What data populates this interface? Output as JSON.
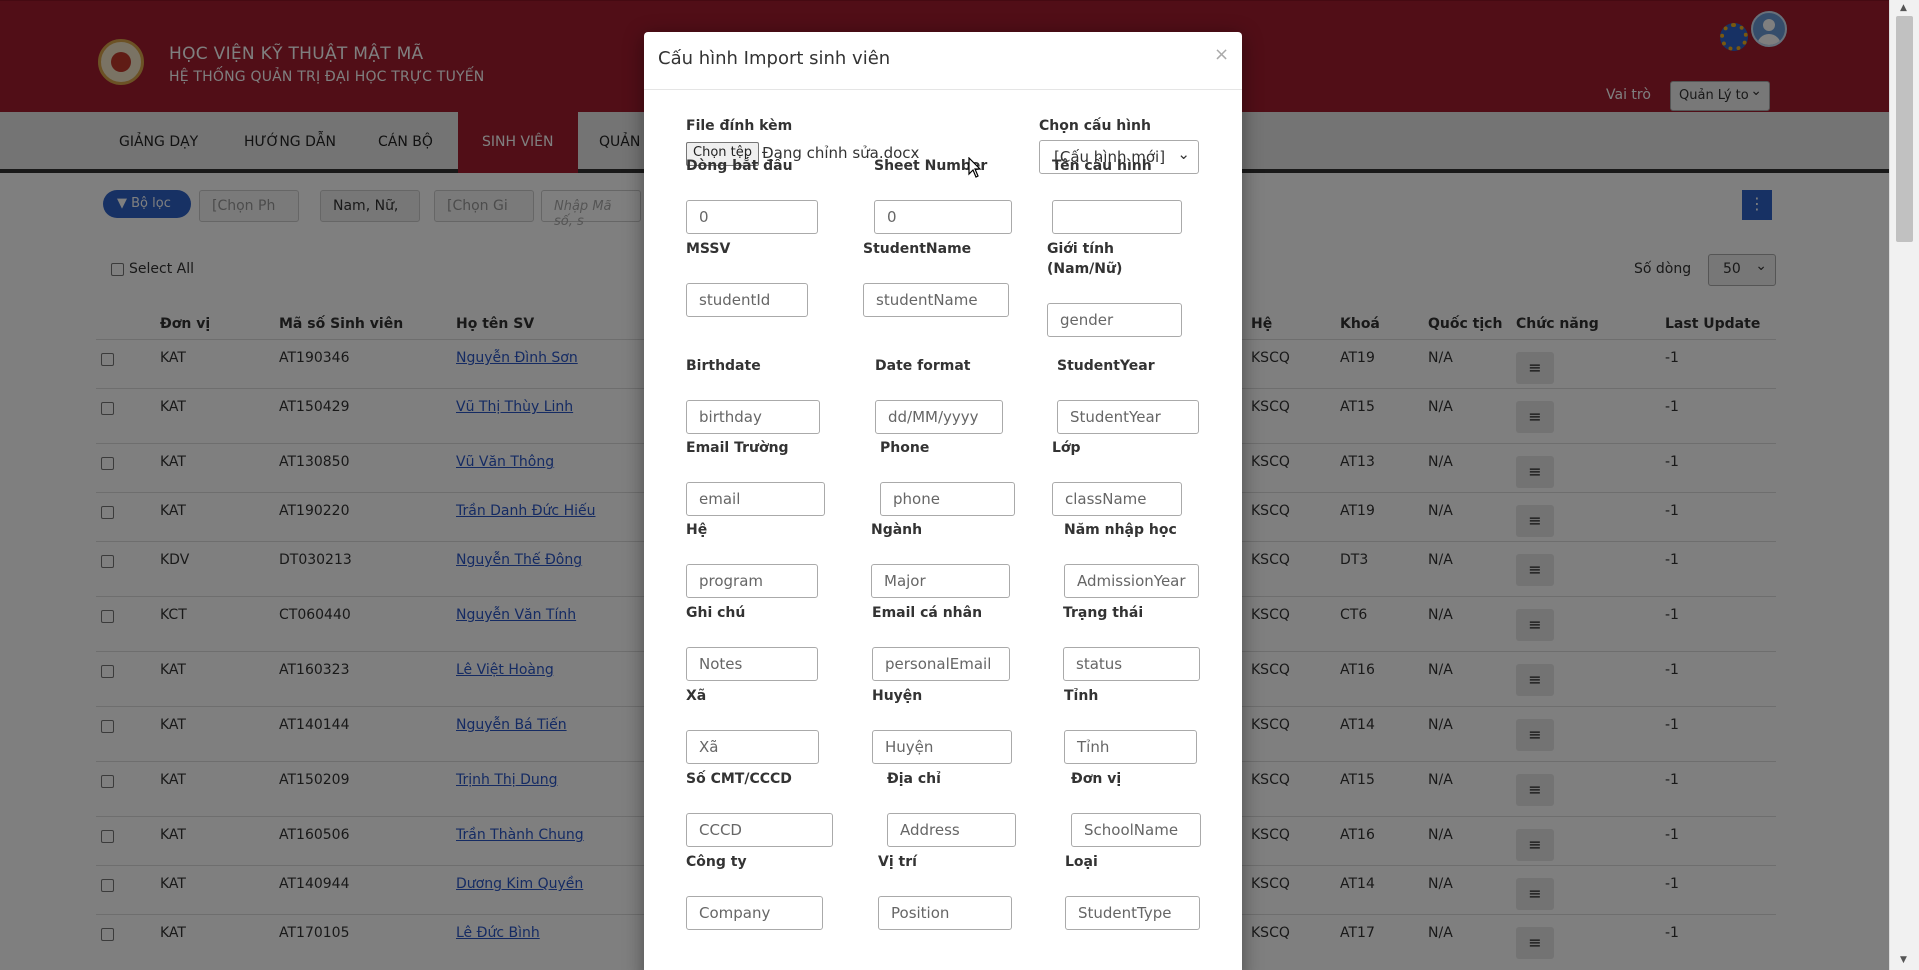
{
  "header": {
    "title1": "HỌC VIỆN KỸ THUẬT MẬT MÃ",
    "title2": "HỆ THỐNG QUẢN TRỊ ĐẠI HỌC TRỰC TUYẾN",
    "role_label": "Vai trò",
    "role_value": "Quản Lý to"
  },
  "nav": [
    "GIẢNG DẠY",
    "HƯỚNG DẪN",
    "CÁN BỘ",
    "SINH VIÊN",
    "QUẢN"
  ],
  "filters": {
    "filter_button": "Bộ lọc",
    "sel1": "[Chọn Ph",
    "sel2": "Nam, Nữ,",
    "sel3": "[Chọn Gi",
    "search_placeholder": "Nhập Mã số, s"
  },
  "toolbar": {
    "select_all": "Select All",
    "rows_label": "Số dòng",
    "rows_value": "50"
  },
  "table": {
    "headers": [
      "Đơn vị",
      "Mã số Sinh viên",
      "Họ tên SV",
      "Hệ",
      "Khoá",
      "Quốc tịch",
      "Chức năng",
      "Last Update"
    ],
    "rows": [
      {
        "dv": "KAT",
        "ma": "AT190346",
        "ten": "Nguyễn Đình Sơn",
        "he": "KSCQ",
        "khoa": "AT19",
        "qt": "N/A",
        "lu": "-1"
      },
      {
        "dv": "KAT",
        "ma": "AT150429",
        "ten": "Vũ Thị Thùy Linh",
        "he": "KSCQ",
        "khoa": "AT15",
        "qt": "N/A",
        "lu": "-1"
      },
      {
        "dv": "KAT",
        "ma": "AT130850",
        "ten": "Vũ Văn Thông",
        "he": "KSCQ",
        "khoa": "AT13",
        "qt": "N/A",
        "lu": "-1"
      },
      {
        "dv": "KAT",
        "ma": "AT190220",
        "ten": "Trần Danh Đức Hiếu",
        "he": "KSCQ",
        "khoa": "AT19",
        "qt": "N/A",
        "lu": "-1"
      },
      {
        "dv": "KDV",
        "ma": "DT030213",
        "ten": "Nguyễn Thế Đông",
        "he": "KSCQ",
        "khoa": "DT3",
        "qt": "N/A",
        "lu": "-1"
      },
      {
        "dv": "KCT",
        "ma": "CT060440",
        "ten": "Nguyễn Văn Tính",
        "he": "KSCQ",
        "khoa": "CT6",
        "qt": "N/A",
        "lu": "-1"
      },
      {
        "dv": "KAT",
        "ma": "AT160323",
        "ten": "Lê Việt Hoàng",
        "he": "KSCQ",
        "khoa": "AT16",
        "qt": "N/A",
        "lu": "-1"
      },
      {
        "dv": "KAT",
        "ma": "AT140144",
        "ten": "Nguyễn Bá Tiến",
        "he": "KSCQ",
        "khoa": "AT14",
        "qt": "N/A",
        "lu": "-1"
      },
      {
        "dv": "KAT",
        "ma": "AT150209",
        "ten": "Trịnh Thị Dung",
        "he": "KSCQ",
        "khoa": "AT15",
        "qt": "N/A",
        "lu": "-1"
      },
      {
        "dv": "KAT",
        "ma": "AT160506",
        "ten": "Trần Thành Chung",
        "he": "KSCQ",
        "khoa": "AT16",
        "qt": "N/A",
        "lu": "-1"
      },
      {
        "dv": "KAT",
        "ma": "AT140944",
        "ten": "Dương Kim Quyền",
        "he": "KSCQ",
        "khoa": "AT14",
        "qt": "N/A",
        "lu": "-1"
      },
      {
        "dv": "KAT",
        "ma": "AT170105",
        "ten": "Lê Đức Bình",
        "he": "KSCQ",
        "khoa": "AT17",
        "qt": "N/A",
        "lu": "-1"
      }
    ]
  },
  "modal": {
    "title": "Cấu hình Import sinh viên",
    "close": "×",
    "file_label": "File đính kèm",
    "file_button": "Chọn tệp",
    "file_name": "Đang chỉnh sửa.docx",
    "config_label": "Chọn cấu hình",
    "config_value": "[Cấu hình mới]",
    "fields": [
      {
        "label": "Dòng bắt đầu",
        "value": "0"
      },
      {
        "label": "Sheet Number",
        "value": "0"
      },
      {
        "label": "Tên cấu hình",
        "value": ""
      },
      {
        "label": "MSSV",
        "value": "studentId"
      },
      {
        "label": "StudentName",
        "value": "studentName"
      },
      {
        "label": "Giới tính (Nam/Nữ)",
        "value": "gender"
      },
      {
        "label": "Birthdate",
        "value": "birthday"
      },
      {
        "label": "Date format",
        "value": "dd/MM/yyyy"
      },
      {
        "label": "StudentYear",
        "value": "StudentYear"
      },
      {
        "label": "Email Trường",
        "value": "email"
      },
      {
        "label": "Phone",
        "value": "phone"
      },
      {
        "label": "Lớp",
        "value": "className"
      },
      {
        "label": "Hệ",
        "value": "program"
      },
      {
        "label": "Ngành",
        "value": "Major"
      },
      {
        "label": "Năm nhập học",
        "value": "AdmissionYear"
      },
      {
        "label": "Ghi chú",
        "value": "Notes"
      },
      {
        "label": "Email cá nhân",
        "value": "personalEmail"
      },
      {
        "label": "Trạng thái",
        "value": "status"
      },
      {
        "label": "Xã",
        "value": "Xã"
      },
      {
        "label": "Huyện",
        "value": "Huyện"
      },
      {
        "label": "Tỉnh",
        "value": "Tỉnh"
      },
      {
        "label": "Số CMT/CCCD",
        "value": "CCCD"
      },
      {
        "label": "Địa chỉ",
        "value": "Address"
      },
      {
        "label": "Đơn vị",
        "value": "SchoolName"
      },
      {
        "label": "Công ty",
        "value": "Company"
      },
      {
        "label": "Vị trí",
        "value": "Position"
      },
      {
        "label": "Loại",
        "value": "StudentType"
      }
    ]
  },
  "icons": {
    "filter": "filter-icon",
    "gear": "gear-icon",
    "avatar": "user-avatar-icon",
    "row_action": "hamburger-icon",
    "more": "more-vertical-icon"
  },
  "colors": {
    "brand": "#a31c2e",
    "accent": "#2e63c9"
  }
}
